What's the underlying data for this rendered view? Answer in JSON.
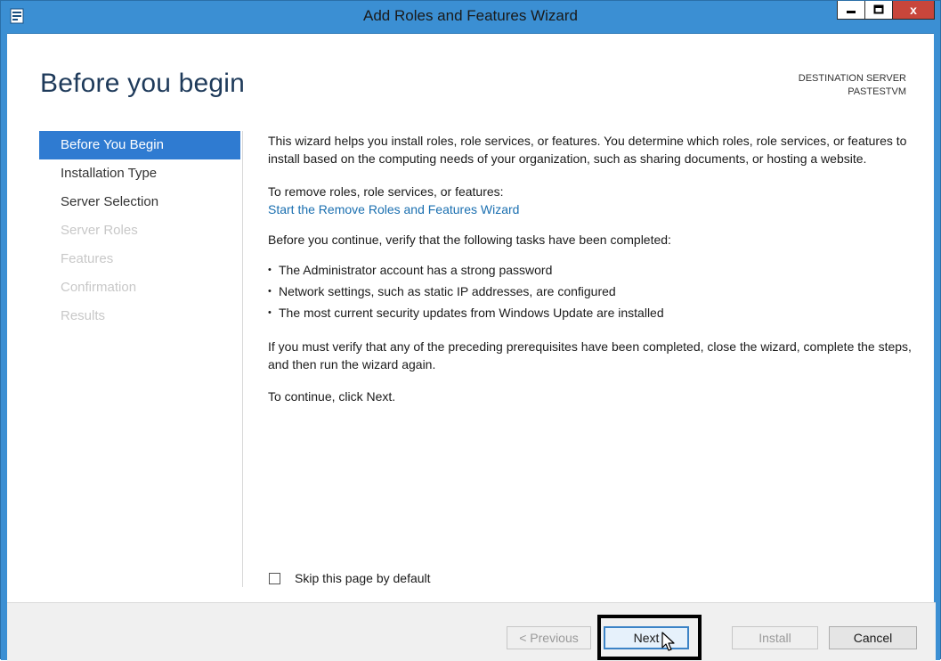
{
  "window": {
    "title": "Add Roles and Features Wizard",
    "controls": [
      "minimize-icon",
      "maximize-icon",
      "close-icon"
    ],
    "close_glyph": "x"
  },
  "header": {
    "page_title": "Before you begin",
    "destination_label": "DESTINATION SERVER",
    "destination_server": "PASTESTVM"
  },
  "nav": {
    "items": [
      {
        "label": "Before You Begin",
        "state": "active"
      },
      {
        "label": "Installation Type",
        "state": "enabled"
      },
      {
        "label": "Server Selection",
        "state": "enabled"
      },
      {
        "label": "Server Roles",
        "state": "disabled"
      },
      {
        "label": "Features",
        "state": "disabled"
      },
      {
        "label": "Confirmation",
        "state": "disabled"
      },
      {
        "label": "Results",
        "state": "disabled"
      }
    ]
  },
  "content": {
    "intro": "This wizard helps you install roles, role services, or features. You determine which roles, role services, or features to install based on the computing needs of your organization, such as sharing documents, or hosting a website.",
    "remove_prompt": "To remove roles, role services, or features:",
    "remove_link": "Start the Remove Roles and Features Wizard",
    "verify_prompt": "Before you continue, verify that the following tasks have been completed:",
    "checklist": [
      "The Administrator account has a strong password",
      "Network settings, such as static IP addresses, are configured",
      "The most current security updates from Windows Update are installed"
    ],
    "prereq_note": "If you must verify that any of the preceding prerequisites have been completed, close the wizard, complete the steps, and then run the wizard again.",
    "continue_note": "To continue, click Next."
  },
  "skip": {
    "label": "Skip this page by default",
    "checked": false
  },
  "buttons": {
    "previous": "< Previous",
    "next": "Next",
    "install": "Install",
    "cancel": "Cancel"
  },
  "colors": {
    "titlebar": "#3b8fd3",
    "active_nav": "#2f7bd1",
    "link": "#1a6fb0",
    "page_title": "#1e3a5a"
  }
}
